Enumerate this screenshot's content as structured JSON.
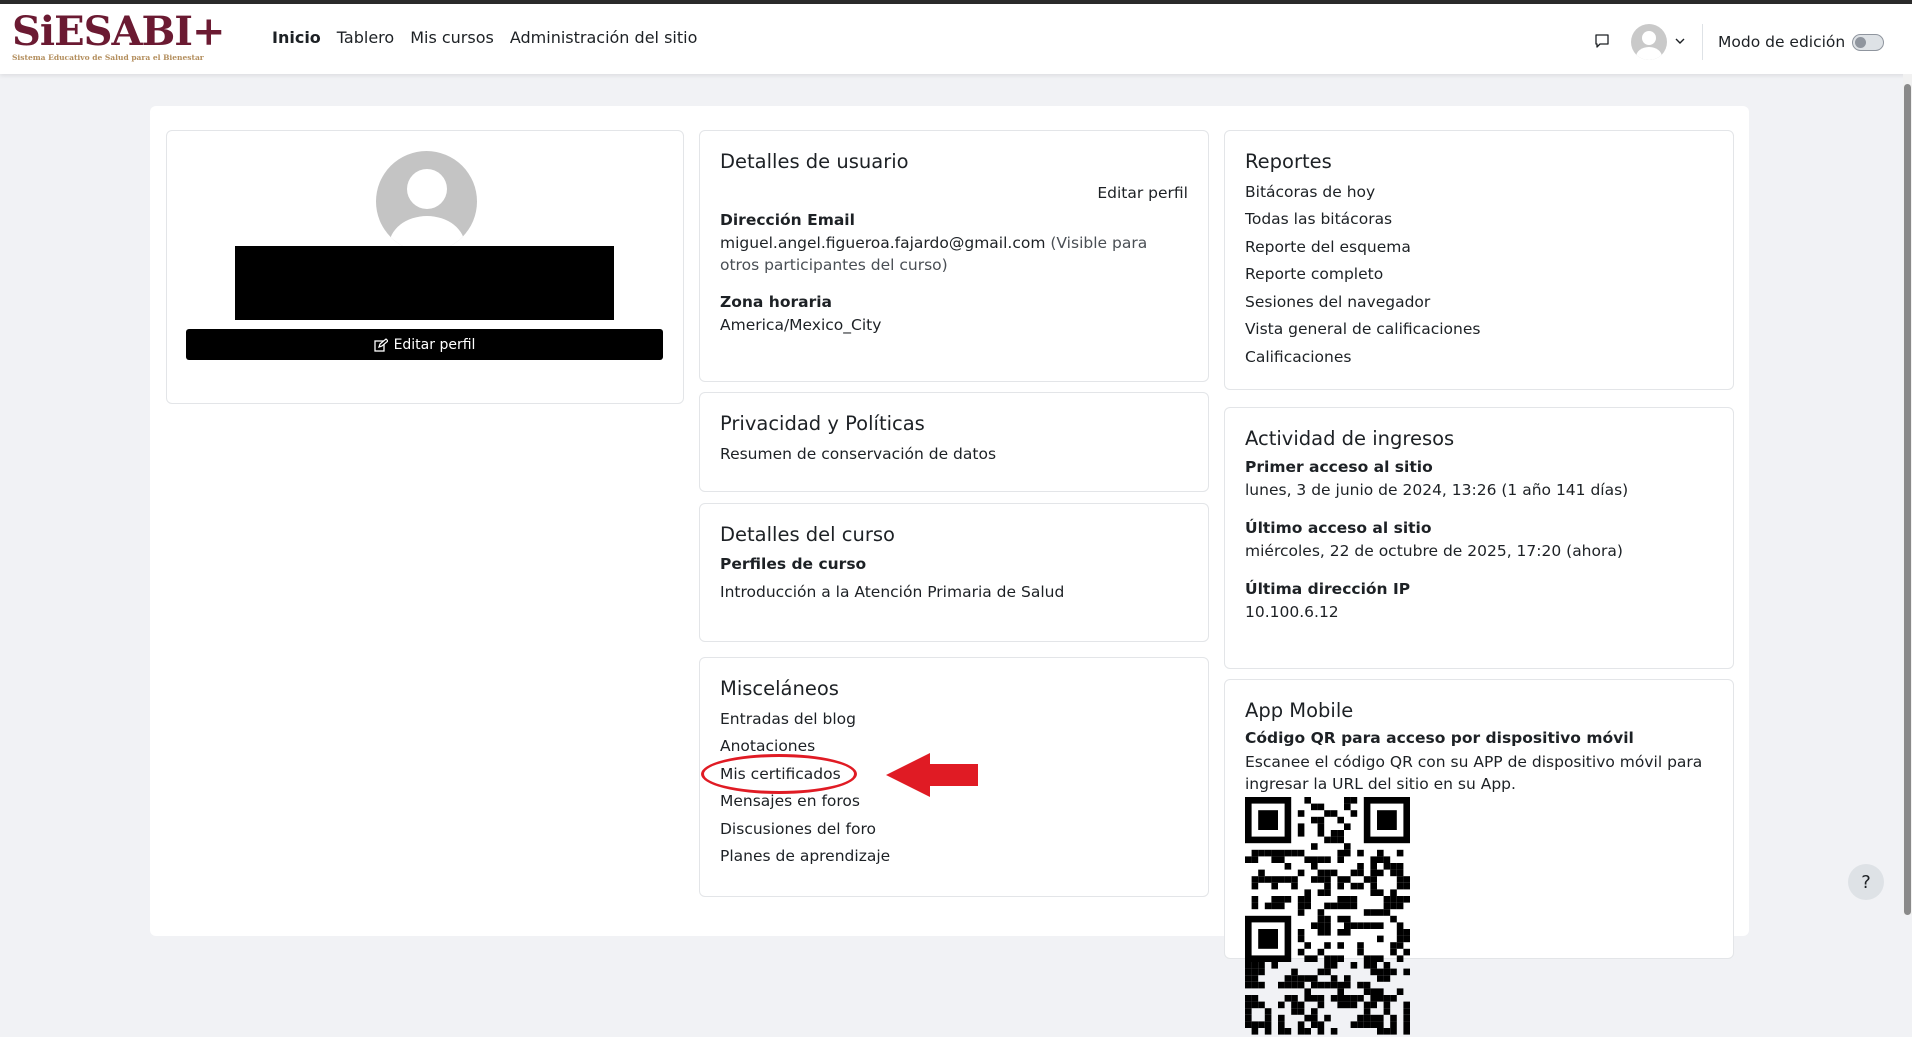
{
  "logo": {
    "text": "SiESABI",
    "plus": "+",
    "subtitle": "Sistema Educativo de Salud para el Bienestar"
  },
  "nav": {
    "home": "Inicio",
    "dashboard": "Tablero",
    "my_courses": "Mis cursos",
    "site_admin": "Administración del sitio"
  },
  "header": {
    "edit_mode_label": "Modo de edición",
    "edit_mode_on": false
  },
  "profile": {
    "edit_button": "Editar perfil"
  },
  "user_details": {
    "title": "Detalles de usuario",
    "edit_link": "Editar perfil",
    "email_label": "Dirección Email",
    "email_value": "miguel.angel.figueroa.fajardo@gmail.com",
    "email_note": "(Visible para otros participantes del curso)",
    "timezone_label": "Zona horaria",
    "timezone_value": "America/Mexico_City"
  },
  "privacy": {
    "title": "Privacidad y Políticas",
    "retention_link": "Resumen de conservación de datos"
  },
  "course_details": {
    "title": "Detalles del curso",
    "profiles_label": "Perfiles de curso",
    "course_link": "Introducción a la Atención Primaria de Salud"
  },
  "misc": {
    "title": "Misceláneos",
    "items": [
      "Entradas del blog",
      "Anotaciones",
      "Mis certificados",
      "Mensajes en foros",
      "Discusiones del foro",
      "Planes de aprendizaje"
    ]
  },
  "reports": {
    "title": "Reportes",
    "items": [
      "Bitácoras de hoy",
      "Todas las bitácoras",
      "Reporte del esquema",
      "Reporte completo",
      "Sesiones del navegador",
      "Vista general de calificaciones",
      "Calificaciones"
    ]
  },
  "login_activity": {
    "title": "Actividad de ingresos",
    "first_access_label": "Primer acceso al sitio",
    "first_access_value": "lunes, 3 de junio de 2024, 13:26  (1 año 141 días)",
    "last_access_label": "Último acceso al sitio",
    "last_access_value": "miércoles, 22 de octubre de 2025, 17:20  (ahora)",
    "last_ip_label": "Última dirección IP",
    "last_ip_value": "10.100.6.12"
  },
  "app_mobile": {
    "title": "App Mobile",
    "qr_label": "Código QR para acceso por dispositivo móvil",
    "qr_text": "Escanee el código QR con su APP de dispositivo móvil para ingresar la URL del sitio en su App."
  },
  "help": {
    "label": "?"
  },
  "colors": {
    "brand": "#6b1a32",
    "brand_secondary": "#b38e5d",
    "annotation": "#e01b24"
  }
}
